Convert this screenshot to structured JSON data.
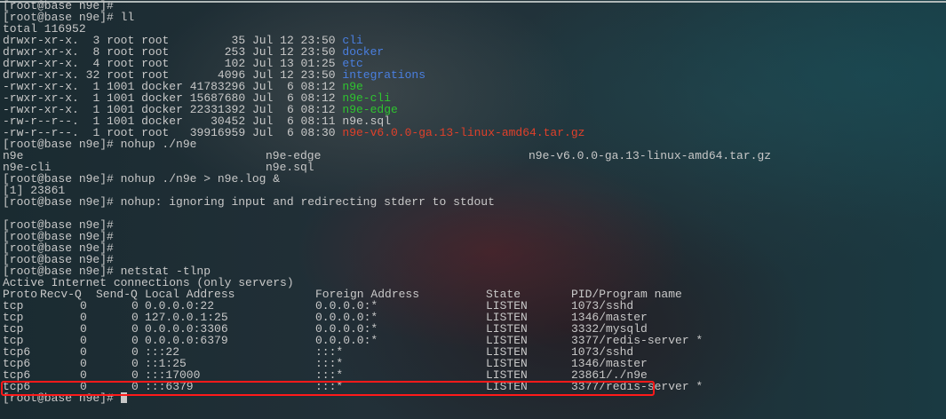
{
  "terminal": {
    "prompt": "[root@base n9e]# ",
    "lines_top": [
      {
        "text": "[root@base n9e]#"
      },
      {
        "text": "[root@base n9e]# ll"
      },
      {
        "text": "total 116952"
      }
    ],
    "listing": [
      {
        "perms": "drwxr-xr-x.",
        "links": " 3",
        "user": "root",
        "group": "root  ",
        "size": "      35",
        "date": "Jul 12 23:50",
        "name": "cli",
        "color": "blue"
      },
      {
        "perms": "drwxr-xr-x.",
        "links": " 8",
        "user": "root",
        "group": "root  ",
        "size": "     253",
        "date": "Jul 12 23:50",
        "name": "docker",
        "color": "blue"
      },
      {
        "perms": "drwxr-xr-x.",
        "links": " 4",
        "user": "root",
        "group": "root  ",
        "size": "     102",
        "date": "Jul 13 01:25",
        "name": "etc",
        "color": "blue"
      },
      {
        "perms": "drwxr-xr-x.",
        "links": "32",
        "user": "root",
        "group": "root  ",
        "size": "    4096",
        "date": "Jul 12 23:50",
        "name": "integrations",
        "color": "blue"
      },
      {
        "perms": "-rwxr-xr-x.",
        "links": " 1",
        "user": "1001",
        "group": "docker",
        "size": "41783296",
        "date": "Jul  6 08:12",
        "name": "n9e",
        "color": "green"
      },
      {
        "perms": "-rwxr-xr-x.",
        "links": " 1",
        "user": "1001",
        "group": "docker",
        "size": "15687680",
        "date": "Jul  6 08:12",
        "name": "n9e-cli",
        "color": "green"
      },
      {
        "perms": "-rwxr-xr-x.",
        "links": " 1",
        "user": "1001",
        "group": "docker",
        "size": "22331392",
        "date": "Jul  6 08:12",
        "name": "n9e-edge",
        "color": "green"
      },
      {
        "perms": "-rw-r--r--.",
        "links": " 1",
        "user": "1001",
        "group": "docker",
        "size": "   30452",
        "date": "Jul  6 08:11",
        "name": "n9e.sql",
        "color": "plain"
      },
      {
        "perms": "-rw-r--r--.",
        "links": " 1",
        "user": "root",
        "group": "root  ",
        "size": "39916959",
        "date": "Jul  6 08:30",
        "name": "n9e-v6.0.0-ga.13-linux-amd64.tar.gz",
        "color": "red"
      }
    ],
    "cmd_nohup_tab": "[root@base n9e]# nohup ./n9e",
    "tab_completion": [
      [
        "n9e",
        "n9e-edge",
        "n9e-v6.0.0-ga.13-linux-amd64.tar.gz"
      ],
      [
        "n9e-cli",
        "n9e.sql",
        ""
      ]
    ],
    "cmd_nohup_run": "[root@base n9e]# nohup ./n9e > n9e.log &",
    "job_line": "[1] 23861",
    "nohup_msg": "[root@base n9e]# nohup: ignoring input and redirecting stderr to stdout",
    "blank": "",
    "empty_prompts": [
      "[root@base n9e]#",
      "[root@base n9e]#",
      "[root@base n9e]#",
      "[root@base n9e]#"
    ],
    "cmd_netstat": "[root@base n9e]# netstat -tlnp",
    "netstat_title": "Active Internet connections (only servers)",
    "netstat_header": {
      "proto": "Proto",
      "recvq": "Recv-Q",
      "sendq": "Send-Q",
      "local": "Local Address",
      "foreign": "Foreign Address",
      "state": "State",
      "pid": "PID/Program name"
    },
    "netstat_rows": [
      {
        "proto": "tcp",
        "recvq": "0",
        "sendq": "0",
        "local": "0.0.0.0:22",
        "foreign": "0.0.0.0:*",
        "state": "LISTEN",
        "pid": "1073/sshd"
      },
      {
        "proto": "tcp",
        "recvq": "0",
        "sendq": "0",
        "local": "127.0.0.1:25",
        "foreign": "0.0.0.0:*",
        "state": "LISTEN",
        "pid": "1346/master"
      },
      {
        "proto": "tcp",
        "recvq": "0",
        "sendq": "0",
        "local": "0.0.0.0:3306",
        "foreign": "0.0.0.0:*",
        "state": "LISTEN",
        "pid": "3332/mysqld"
      },
      {
        "proto": "tcp",
        "recvq": "0",
        "sendq": "0",
        "local": "0.0.0.0:6379",
        "foreign": "0.0.0.0:*",
        "state": "LISTEN",
        "pid": "3377/redis-server *"
      },
      {
        "proto": "tcp6",
        "recvq": "0",
        "sendq": "0",
        "local": ":::22",
        "foreign": ":::*",
        "state": "LISTEN",
        "pid": "1073/sshd"
      },
      {
        "proto": "tcp6",
        "recvq": "0",
        "sendq": "0",
        "local": "::1:25",
        "foreign": ":::*",
        "state": "LISTEN",
        "pid": "1346/master"
      },
      {
        "proto": "tcp6",
        "recvq": "0",
        "sendq": "0",
        "local": ":::17000",
        "foreign": ":::*",
        "state": "LISTEN",
        "pid": "23861/./n9e"
      },
      {
        "proto": "tcp6",
        "recvq": "0",
        "sendq": "0",
        "local": ":::6379",
        "foreign": ":::*",
        "state": "LISTEN",
        "pid": "3377/redis-server *"
      }
    ],
    "final_prompt": "[root@base n9e]# ",
    "colors": {
      "directory": "#4a7fe0",
      "executable": "#2fc42f",
      "archive": "#e0402a",
      "text": "#c8c8c8",
      "highlight_box": "#ff1a1a"
    },
    "highlighted_row_index": 6
  }
}
